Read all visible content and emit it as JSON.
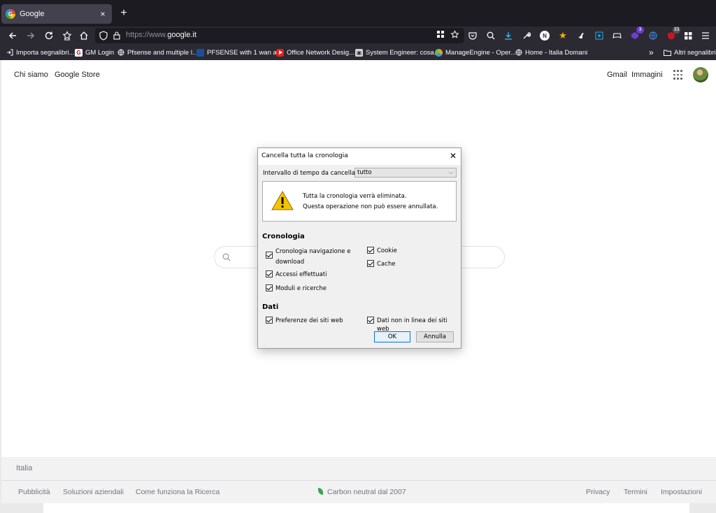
{
  "browser": {
    "tab": {
      "title": "Google",
      "close": "×"
    },
    "new_tab": "+",
    "url": {
      "prefix": "https://www.",
      "domain": "google.it"
    },
    "extension_badges": {
      "ext_1": "3",
      "ext_2": "33"
    },
    "extension_letters": {
      "n": "N"
    },
    "bookmarks": [
      {
        "label": "Importa segnalibri..."
      },
      {
        "label": "GM Login"
      },
      {
        "label": "Pfsense and multiple l..."
      },
      {
        "label": "PFSENSE with 1 wan a..."
      },
      {
        "label": "Office Network Desig..."
      },
      {
        "label": "System Engineer: cosa..."
      },
      {
        "label": "ManageEngine - Oper..."
      },
      {
        "label": "Home - Italia Domani"
      }
    ],
    "other_bookmarks": "Altri segnalibri",
    "overflow": "»"
  },
  "page": {
    "header_left": {
      "about": "Chi siamo",
      "store": "Google Store"
    },
    "header_right": {
      "gmail": "Gmail",
      "images": "Immagini"
    },
    "footer": {
      "country": "Italia",
      "left_links": [
        "Pubblicità",
        "Soluzioni aziendali",
        "Come funziona la Ricerca"
      ],
      "center": "Carbon neutral dal 2007",
      "right_links": [
        "Privacy",
        "Termini",
        "Impostazioni"
      ]
    }
  },
  "dialog": {
    "title": "Cancella tutta la cronologia",
    "close": "✕",
    "range_label": "Intervallo di tempo da cancellare:",
    "range_value": "tutto",
    "warning_line1": "Tutta la cronologia verrà eliminata.",
    "warning_line2": "Questa operazione non può essere annullata.",
    "section_history": "Cronologia",
    "history_items": [
      {
        "label": "Cronologia navigazione e download",
        "checked": true
      },
      {
        "label": "Accessi effettuati",
        "checked": true
      },
      {
        "label": "Moduli e ricerche",
        "checked": true
      },
      {
        "label": "Cookie",
        "checked": true
      },
      {
        "label": "Cache",
        "checked": true
      }
    ],
    "section_data": "Dati",
    "data_items": [
      {
        "label": "Preferenze dei siti web",
        "checked": true
      },
      {
        "label": "Dati non in linea dei siti web",
        "checked": true
      }
    ],
    "ok": "OK",
    "cancel": "Annulla"
  },
  "colors": {
    "chrome_dark": "#1c1b22",
    "toolbar": "#2b2a33",
    "dialog_bg": "#f0f0f0",
    "ok_border": "#0078d7"
  }
}
